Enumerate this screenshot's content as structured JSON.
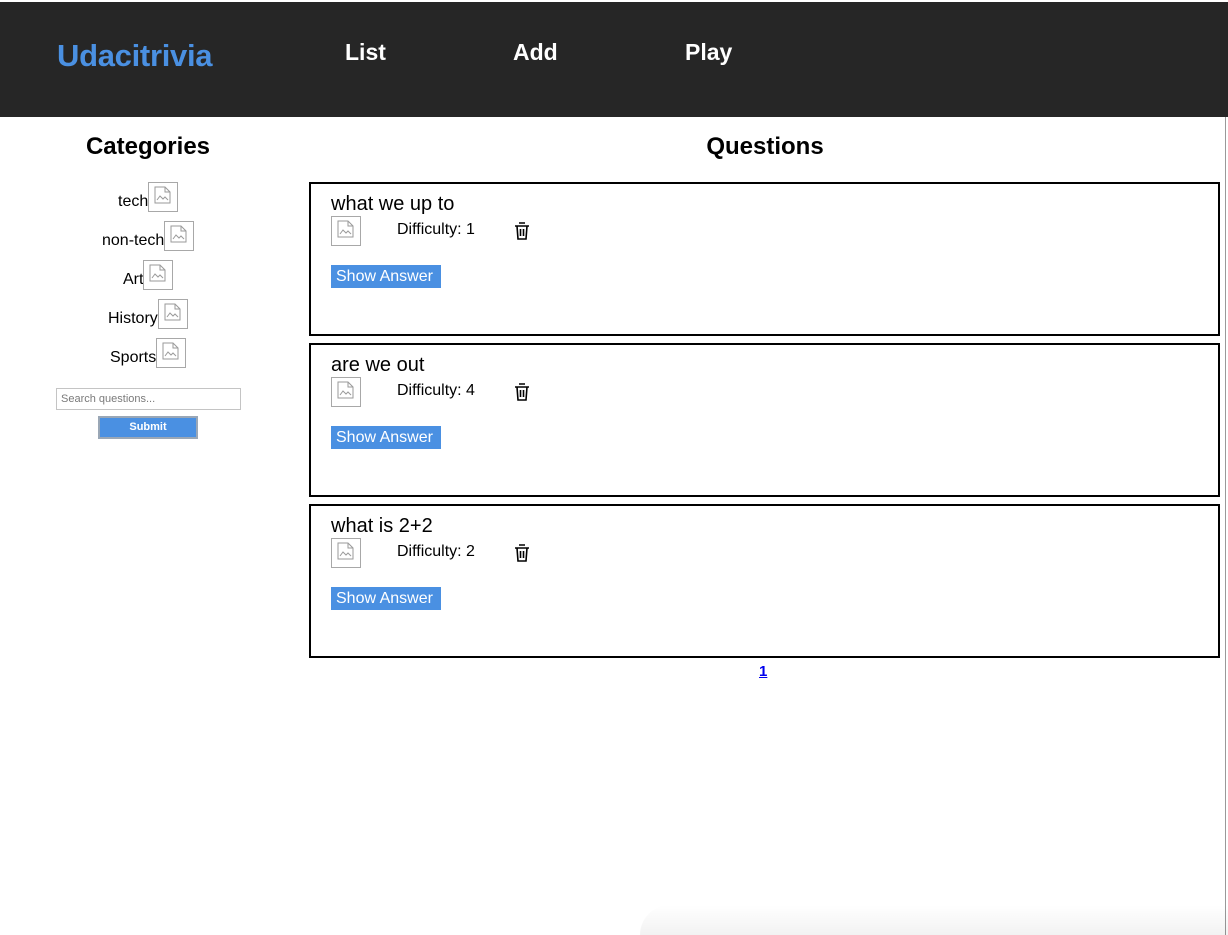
{
  "header": {
    "brand": "Udacitrivia",
    "nav": [
      {
        "label": "List"
      },
      {
        "label": "Add"
      },
      {
        "label": "Play"
      }
    ]
  },
  "categories": {
    "title": "Categories",
    "items": [
      {
        "label": "tech"
      },
      {
        "label": "non-tech"
      },
      {
        "label": "Art"
      },
      {
        "label": "History"
      },
      {
        "label": "Sports"
      }
    ]
  },
  "search": {
    "placeholder": "Search questions...",
    "value": "",
    "submit_label": "Submit"
  },
  "questions": {
    "title": "Questions",
    "items": [
      {
        "text": "what we up to",
        "difficulty": "Difficulty: 1",
        "show_answer": "Show Answer"
      },
      {
        "text": "are we out",
        "difficulty": "Difficulty: 4",
        "show_answer": "Show Answer"
      },
      {
        "text": "what is 2+2",
        "difficulty": "Difficulty: 2",
        "show_answer": "Show Answer"
      }
    ]
  },
  "pagination": {
    "current": "1"
  },
  "colors": {
    "accent": "#4a90e2",
    "header_bg": "#262626"
  }
}
